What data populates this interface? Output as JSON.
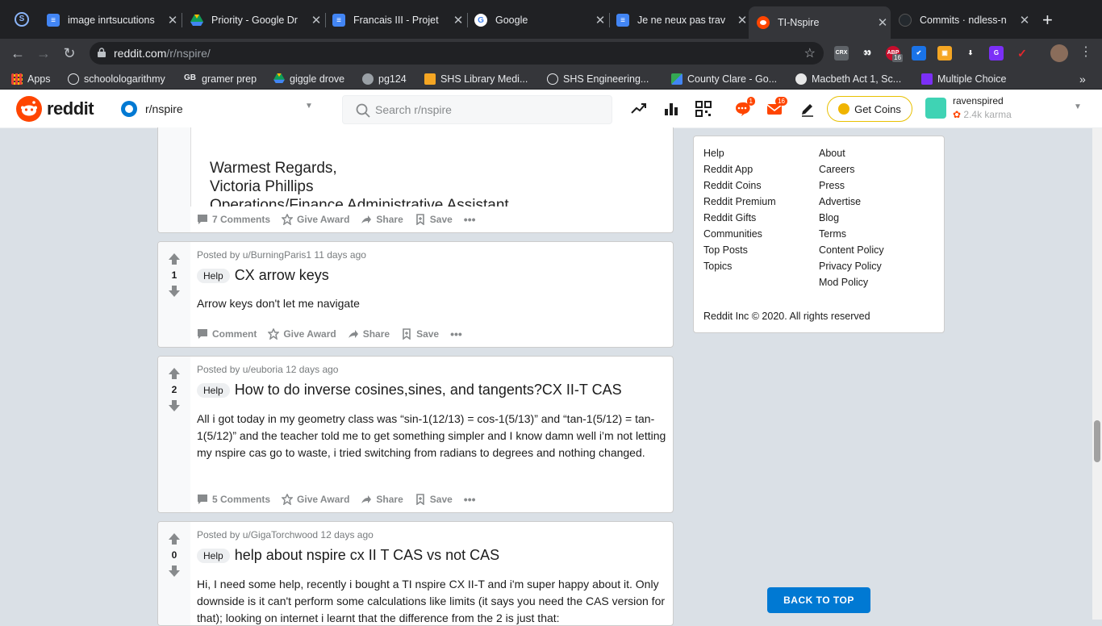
{
  "browser": {
    "tabs": [
      {
        "title": "image inrtsucutions",
        "fav_color": "#4285f4",
        "fav_glyph": "≡",
        "icon": "docs-icon"
      },
      {
        "title": "Priority - Google Dr",
        "fav_color": "#0f9d58",
        "fav_glyph": "▲",
        "icon": "drive-icon"
      },
      {
        "title": "Francais III - Projet",
        "fav_color": "#4285f4",
        "fav_glyph": "≡",
        "icon": "docs-icon"
      },
      {
        "title": "Google",
        "fav_color": "#ffffff",
        "fav_glyph": "G",
        "icon": "google-icon"
      },
      {
        "title": "Je ne neux pas trav",
        "fav_color": "#4285f4",
        "fav_glyph": "≡",
        "icon": "docs-icon"
      },
      {
        "title": "TI-Nspire",
        "fav_color": "#ff4500",
        "fav_glyph": "●",
        "icon": "reddit-icon"
      },
      {
        "title": "Commits · ndless-n",
        "fav_color": "#24292e",
        "fav_glyph": "●",
        "icon": "github-icon"
      }
    ],
    "url_domain": "reddit.com",
    "url_path": "/r/nspire/",
    "extensions": [
      {
        "label": "CRX",
        "color": "#5f6368"
      },
      {
        "label": "👀",
        "color": "#35363a"
      },
      {
        "label": "ABP",
        "color": "#c70d2c"
      },
      {
        "label": "✔",
        "color": "#1a73e8"
      },
      {
        "label": "▣",
        "color": "#f5a623"
      },
      {
        "label": "⬇",
        "color": "#35363a"
      },
      {
        "label": "G",
        "color": "#7b2ff7"
      },
      {
        "label": "✓",
        "color": "#e8272c"
      },
      {
        "label": "",
        "color": "#8a6d5b"
      }
    ],
    "ext_badge": "16",
    "bookmarks": [
      {
        "label": "Apps",
        "color": "#e94235"
      },
      {
        "label": "schoolologarithmy",
        "color": "#35363a"
      },
      {
        "label": "gramer prep",
        "color": "#35363a"
      },
      {
        "label": "giggle drove",
        "color": "#0f9d58"
      },
      {
        "label": "pg124",
        "color": "#9aa0a6"
      },
      {
        "label": "SHS Library Medi...",
        "color": "#f5a623"
      },
      {
        "label": "SHS Engineering...",
        "color": "#35363a"
      },
      {
        "label": "County Clare - Go...",
        "color": "#34a853"
      },
      {
        "label": "Macbeth Act 1, Sc...",
        "color": "#e8e8e8"
      },
      {
        "label": "Multiple Choice",
        "color": "#7b2ff7"
      }
    ],
    "bookmarks_more": "»"
  },
  "reddit": {
    "logo_text": "reddit",
    "community": "r/nspire",
    "search_placeholder": "Search r/nspire",
    "chat_badge": "1",
    "mail_badge": "16",
    "get_coins": "Get Coins",
    "username": "ravenspired",
    "karma": "2.4k karma"
  },
  "posts": [
    {
      "image_lines": [
        "Warmest Regards,",
        "Victoria Phillips",
        "Operations/Finance Administrative Assistant"
      ],
      "comments": "7 Comments",
      "give_award": "Give Award",
      "share": "Share",
      "save": "Save"
    },
    {
      "votes": "1",
      "meta": "Posted by u/BurningParis1 11 days ago",
      "flair": "Help",
      "title": "CX arrow keys",
      "body": "Arrow keys don't let me navigate",
      "comments": "Comment",
      "give_award": "Give Award",
      "share": "Share",
      "save": "Save"
    },
    {
      "votes": "2",
      "meta": "Posted by u/euboria 12 days ago",
      "flair": "Help",
      "title": "How to do inverse cosines,sines, and tangents?CX II-T CAS",
      "body": "All i got today in my geometry class was “sin-1(12/13) = cos-1(5/13)” and “tan-1(5/12) = tan-1(5/12)” and the teacher told me to get something simpler and I know damn well i’m not letting my nspire cas go to waste, i tried switching from radians to degrees and nothing changed.",
      "comments": "5 Comments",
      "give_award": "Give Award",
      "share": "Share",
      "save": "Save"
    },
    {
      "votes": "0",
      "meta": "Posted by u/GigaTorchwood 12 days ago",
      "flair": "Help",
      "title": "help about nspire cx II T CAS vs not CAS",
      "body": "Hi, I need some help, recently i bought a TI nspire CX II-T and i'm super happy about it. Only downside is it can't perform some calculations like limits (it says you need the CAS version for that); looking on internet i learnt that the difference from the 2 is just that:"
    }
  ],
  "footer": {
    "col1": [
      "Help",
      "Reddit App",
      "Reddit Coins",
      "Reddit Premium",
      "Reddit Gifts",
      "Communities",
      "Top Posts",
      "Topics"
    ],
    "col2": [
      "About",
      "Careers",
      "Press",
      "Advertise",
      "Blog",
      "Terms",
      "Content Policy",
      "Privacy Policy",
      "Mod Policy"
    ],
    "copyright": "Reddit Inc © 2020. All rights reserved"
  },
  "back_to_top": "BACK TO TOP"
}
